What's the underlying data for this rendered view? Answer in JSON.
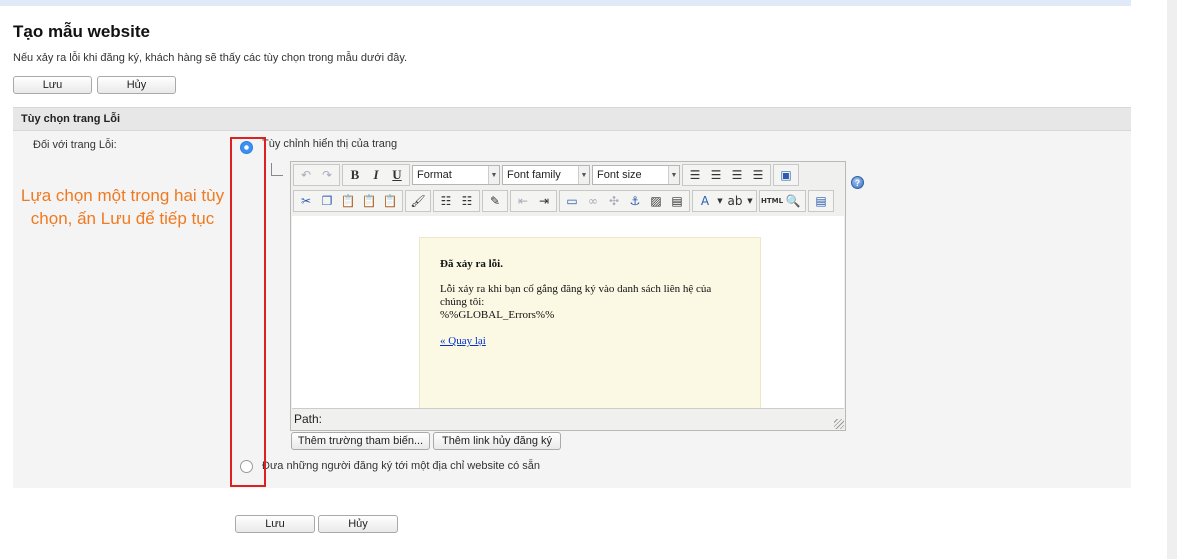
{
  "page": {
    "title": "Tạo mẫu website",
    "description": "Nếu xảy ra lỗi khi đăng ký, khách hàng sẽ thấy các tùy chọn trong mẫu dưới đây."
  },
  "top_buttons": {
    "save": "Lưu",
    "cancel": "Hủy"
  },
  "panel": {
    "header": "Tùy chọn trang Lỗi",
    "field_label": "Đối với trang Lỗi:",
    "option_custom": "Tùy chỉnh hiển thị của trang",
    "option_redirect": "Đưa những người đăng ký tới một địa chỉ website có sẵn"
  },
  "editor": {
    "format_select": "Format",
    "font_family_select": "Font family",
    "font_size_select": "Font size",
    "bold": "B",
    "italic": "I",
    "underline": "U",
    "html_button": "HTML",
    "path_label": "Path:",
    "content": {
      "title": "Đã xảy ra lỗi.",
      "body_line1": "Lỗi xảy ra khi bạn cố gắng đăng ký vào danh sách liên hệ của",
      "body_line2": "chúng tôi:",
      "errors_token": "%%GLOBAL_Errors%%",
      "back_link": "« Quay lại"
    }
  },
  "editor_buttons": {
    "insert_field": "Thêm trường tham biến...",
    "insert_unsub": "Thêm link hủy đăng ký"
  },
  "annotation": {
    "text": "Lựa chọn một trong hai tùy chọn, ấn Lưu để tiếp tục",
    "color": "#f07a20",
    "box_color": "#e02020"
  },
  "bottom_buttons": {
    "save": "Lưu",
    "cancel": "Hủy"
  }
}
